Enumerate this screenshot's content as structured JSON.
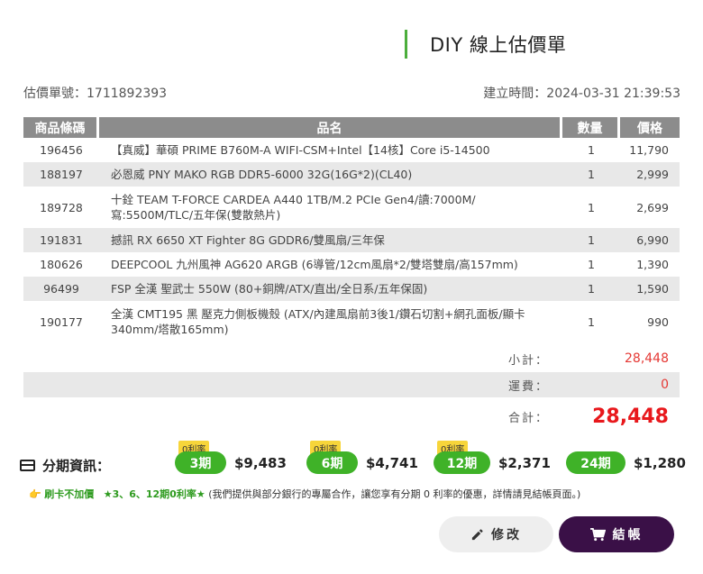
{
  "header": {
    "title": "DIY 線上估價單"
  },
  "meta": {
    "quote_no": "估價單號：1711892393",
    "created": "建立時間：2024-03-31 21:39:53"
  },
  "table": {
    "columns": [
      "商品條碼",
      "品名",
      "數量",
      "價格"
    ],
    "rows": [
      {
        "code": "196456",
        "name": "【真威】華碩 PRIME B760M-A WIFI-CSM+Intel【14核】Core i5-14500",
        "qty": "1",
        "price": "11,790"
      },
      {
        "code": "188197",
        "name": "必恩威 PNY MAKO RGB DDR5-6000 32G(16G*2)(CL40)",
        "qty": "1",
        "price": "2,999"
      },
      {
        "code": "189728",
        "name": "十銓 TEAM T-FORCE CARDEA A440 1TB/M.2 PCIe Gen4/讀:7000M/寫:5500M/TLC/五年保(雙散熱片)",
        "qty": "1",
        "price": "2,699"
      },
      {
        "code": "191831",
        "name": "撼訊 RX 6650 XT Fighter 8G GDDR6/雙風扇/三年保",
        "qty": "1",
        "price": "6,990"
      },
      {
        "code": "180626",
        "name": "DEEPCOOL 九州風神 AG620 ARGB (6導管/12cm風扇*2/雙塔雙扇/高157mm)",
        "qty": "1",
        "price": "1,390"
      },
      {
        "code": "96499",
        "name": "FSP 全漢 聖武士 550W (80+銅牌/ATX/直出/全日系/五年保固)",
        "qty": "1",
        "price": "1,590"
      },
      {
        "code": "190177",
        "name": "全漢 CMT195 黑 壓克力側板機殼 (ATX/內建風扇前3後1/鑽石切割+網孔面板/顯卡340mm/塔散165mm)",
        "qty": "1",
        "price": "990"
      }
    ]
  },
  "summary": {
    "subtotal_label": "小計：",
    "subtotal": "28,448",
    "shipping_label": "運費：",
    "shipping": "0",
    "total_label": "合計：",
    "total": "28,448"
  },
  "installments": {
    "label": "分期資訊：",
    "zero_tag": "0利率",
    "plans": [
      {
        "term": "3期",
        "amount": "$9,483",
        "zero": true
      },
      {
        "term": "6期",
        "amount": "$4,741",
        "zero": true
      },
      {
        "term": "12期",
        "amount": "$2,371",
        "zero": true
      },
      {
        "term": "24期",
        "amount": "$1,280",
        "zero": false
      }
    ]
  },
  "note": {
    "icon": "👉",
    "part1": "刷卡不加價",
    "part2": "★3、6、12期0利率★",
    "part3": "(我們提供與部分銀行的專屬合作，讓您享有分期 0 利率的優惠，詳情請見結帳頁面。)"
  },
  "buttons": {
    "edit": "修改",
    "checkout": "結帳"
  },
  "colors": {
    "accent_green": "#3fb228",
    "price_red": "#e53935",
    "checkout_bg": "#3a1047",
    "zero_tag_bg": "#f7d53a"
  }
}
